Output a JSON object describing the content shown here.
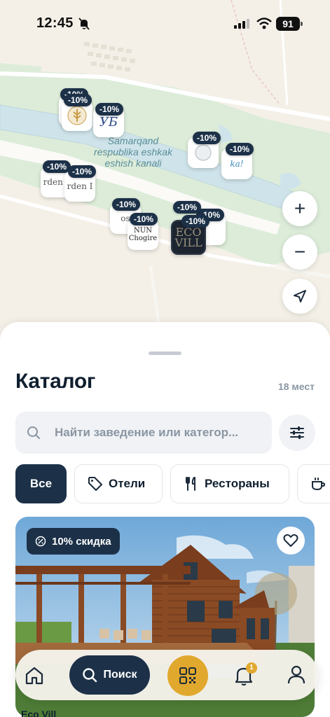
{
  "status_bar": {
    "time": "12:45",
    "battery": "91"
  },
  "map": {
    "water_label": "Samarqand respublika eshkak eshish kanali",
    "pins": [
      {
        "name": "pin-1",
        "badge": "-10%",
        "logo": ""
      },
      {
        "name": "pin-2",
        "badge": "-10%",
        "logo": ""
      },
      {
        "name": "pin-3",
        "badge": "-10%",
        "logo": "УБ"
      },
      {
        "name": "pin-4",
        "badge": "-10%",
        "logo": ""
      },
      {
        "name": "pin-5",
        "badge": "-10%",
        "logo": "ka!"
      },
      {
        "name": "pin-6",
        "badge": "-10%",
        "logo": "rden I"
      },
      {
        "name": "pin-7",
        "badge": "-10%",
        "logo": "rden I"
      },
      {
        "name": "pin-8",
        "badge": "-10%",
        "logo": "os"
      },
      {
        "name": "pin-9",
        "badge": "-10%",
        "logo": "NUN Chogire"
      },
      {
        "name": "pin-10",
        "badge": "-10%",
        "logo": ""
      },
      {
        "name": "pin-11",
        "badge": "-10%",
        "logo": "ECO VILL"
      },
      {
        "name": "pin-12",
        "badge": "-10%",
        "logo": ""
      }
    ],
    "zoom_in": "+",
    "zoom_out": "−"
  },
  "catalog": {
    "title": "Каталог",
    "count": "18 мест",
    "search_placeholder": "Найти заведение или категор...",
    "chips": [
      {
        "label": "Все",
        "active": true
      },
      {
        "label": "Отели",
        "icon": "tag-icon"
      },
      {
        "label": "Рестораны",
        "icon": "fork-knife-icon"
      },
      {
        "label": "",
        "icon": "coffee-icon"
      }
    ],
    "card": {
      "discount": "10% скидка",
      "title_peek": "Eco Vill"
    }
  },
  "nav": {
    "search_label": "Поиск",
    "notification_count": "1"
  },
  "colors": {
    "accent": "#1c3148",
    "gold": "#e1a82e",
    "water": "#cfe4ea",
    "park": "#dceedd"
  }
}
